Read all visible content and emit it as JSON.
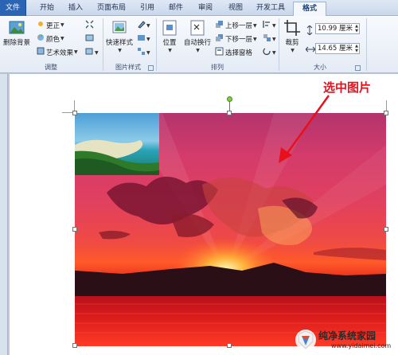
{
  "tabs": [
    "文件",
    "开始",
    "插入",
    "页面布局",
    "引用",
    "邮件",
    "审阅",
    "视图",
    "开发工具",
    "格式"
  ],
  "ribbon": {
    "adjust": {
      "remove_bg": "删除背景",
      "corrections": "更正",
      "color": "颜色",
      "artistic": "艺术效果",
      "label": "调整"
    },
    "styles": {
      "quick_styles": "快速样式",
      "label": "图片样式"
    },
    "arrange": {
      "position": "位置",
      "wrap": "自动换行",
      "bring_forward": "上移一层",
      "send_backward": "下移一层",
      "selection_pane": "选择窗格",
      "label": "排列"
    },
    "size": {
      "crop": "裁剪",
      "height": "10.99 厘米",
      "width": "14.65 厘米",
      "label": "大小"
    }
  },
  "annotation": "选中图片",
  "watermark": {
    "title": "纯净系统家园",
    "url": "www.yidaimei.com"
  },
  "colors": {
    "file_tab": "#2b63b5",
    "callout": "#e8101c",
    "rotation_handle": "#7fce3e"
  }
}
